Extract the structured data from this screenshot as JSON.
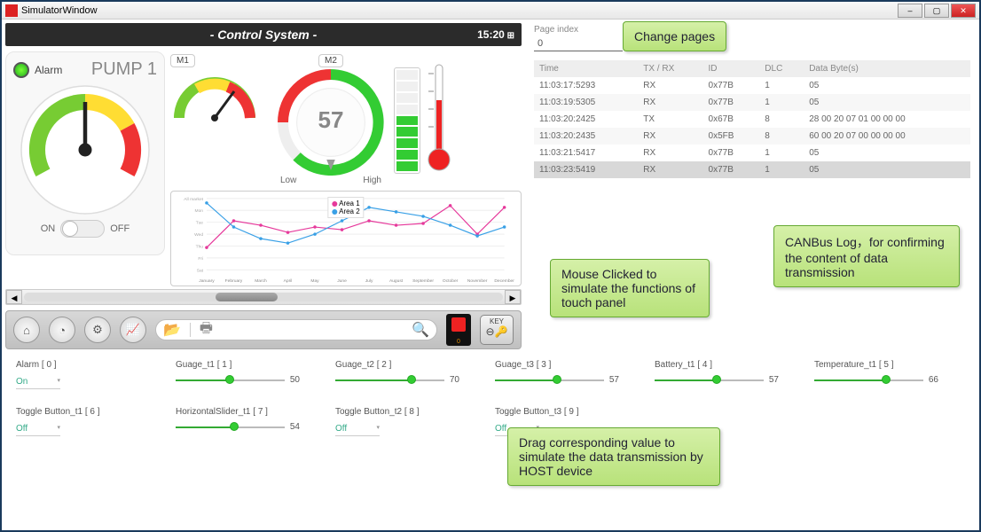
{
  "window": {
    "title": "SimulatorWindow"
  },
  "dashboard": {
    "title": "- Control System -",
    "time": "15:20",
    "pump": {
      "alarm_label": "Alarm",
      "name": "PUMP 1",
      "on_label": "ON",
      "off_label": "OFF"
    },
    "m1": {
      "label": "M1"
    },
    "m2": {
      "label": "M2",
      "value": "57",
      "low": "Low",
      "high": "High"
    },
    "toolbar": {
      "home": "home",
      "gauge": "gauge",
      "gear": "gear",
      "chart": "chart",
      "open": "open",
      "print": "print",
      "search": "search",
      "key_label": "KEY"
    }
  },
  "right": {
    "page_index_label": "Page index",
    "page_index_value": "0",
    "headers": {
      "time": "Time",
      "txrx": "TX / RX",
      "id": "ID",
      "dlc": "DLC",
      "data": "Data Byte(s)"
    },
    "rows": [
      {
        "time": "11:03:17:5293",
        "txrx": "RX",
        "id": "0x77B",
        "dlc": "1",
        "data": "05"
      },
      {
        "time": "11:03:19:5305",
        "txrx": "RX",
        "id": "0x77B",
        "dlc": "1",
        "data": "05"
      },
      {
        "time": "11:03:20:2425",
        "txrx": "TX",
        "id": "0x67B",
        "dlc": "8",
        "data": "28 00 20 07 01 00 00 00"
      },
      {
        "time": "11:03:20:2435",
        "txrx": "RX",
        "id": "0x5FB",
        "dlc": "8",
        "data": "60 00 20 07 00 00 00 00"
      },
      {
        "time": "11:03:21:5417",
        "txrx": "RX",
        "id": "0x77B",
        "dlc": "1",
        "data": "05"
      },
      {
        "time": "11:03:23:5419",
        "txrx": "RX",
        "id": "0x77B",
        "dlc": "1",
        "data": "05"
      }
    ]
  },
  "callouts": {
    "c1": "Change pages",
    "c2": "Mouse Clicked to simulate the functions of touch panel",
    "c3": "CANBus Log，for confirming the content of data transmission",
    "c4": "Drag corresponding value to simulate the data transmission by HOST device"
  },
  "controls": [
    {
      "label": "Alarm  [ 0 ]",
      "type": "dropdown",
      "value": "On"
    },
    {
      "label": "Guage_t1  [ 1 ]",
      "type": "slider",
      "value": "50",
      "pct": 50
    },
    {
      "label": "Guage_t2  [ 2 ]",
      "type": "slider",
      "value": "70",
      "pct": 70
    },
    {
      "label": "Guage_t3  [ 3 ]",
      "type": "slider",
      "value": "57",
      "pct": 57
    },
    {
      "label": "Battery_t1  [ 4 ]",
      "type": "slider",
      "value": "57",
      "pct": 57
    },
    {
      "label": "Temperature_t1  [ 5 ]",
      "type": "slider",
      "value": "66",
      "pct": 66
    },
    {
      "label": "Toggle Button_t1  [ 6 ]",
      "type": "dropdown",
      "value": "Off"
    },
    {
      "label": "HorizontalSlider_t1  [ 7 ]",
      "type": "slider",
      "value": "54",
      "pct": 54
    },
    {
      "label": "Toggle Button_t2  [ 8 ]",
      "type": "dropdown",
      "value": "Off"
    },
    {
      "label": "Toggle Button_t3  [ 9 ]",
      "type": "dropdown",
      "value": "Off"
    }
  ],
  "chart_data": {
    "type": "line",
    "categories": [
      "January",
      "February",
      "March",
      "April",
      "May",
      "June",
      "July",
      "August",
      "September",
      "October",
      "November",
      "December"
    ],
    "series": [
      {
        "name": "Area 1",
        "color": "#e6399b",
        "values": [
          25,
          55,
          50,
          42,
          48,
          45,
          55,
          50,
          52,
          72,
          40,
          70
        ]
      },
      {
        "name": "Area 2",
        "color": "#39a0e6",
        "values": [
          75,
          48,
          35,
          30,
          40,
          55,
          70,
          65,
          60,
          50,
          38,
          48
        ]
      }
    ],
    "ylim": [
      0,
      80
    ]
  },
  "colors": {
    "danger": "#dd3322",
    "ok": "#33cc33",
    "warn": "#f0c000",
    "accent": "#39a0e6"
  }
}
